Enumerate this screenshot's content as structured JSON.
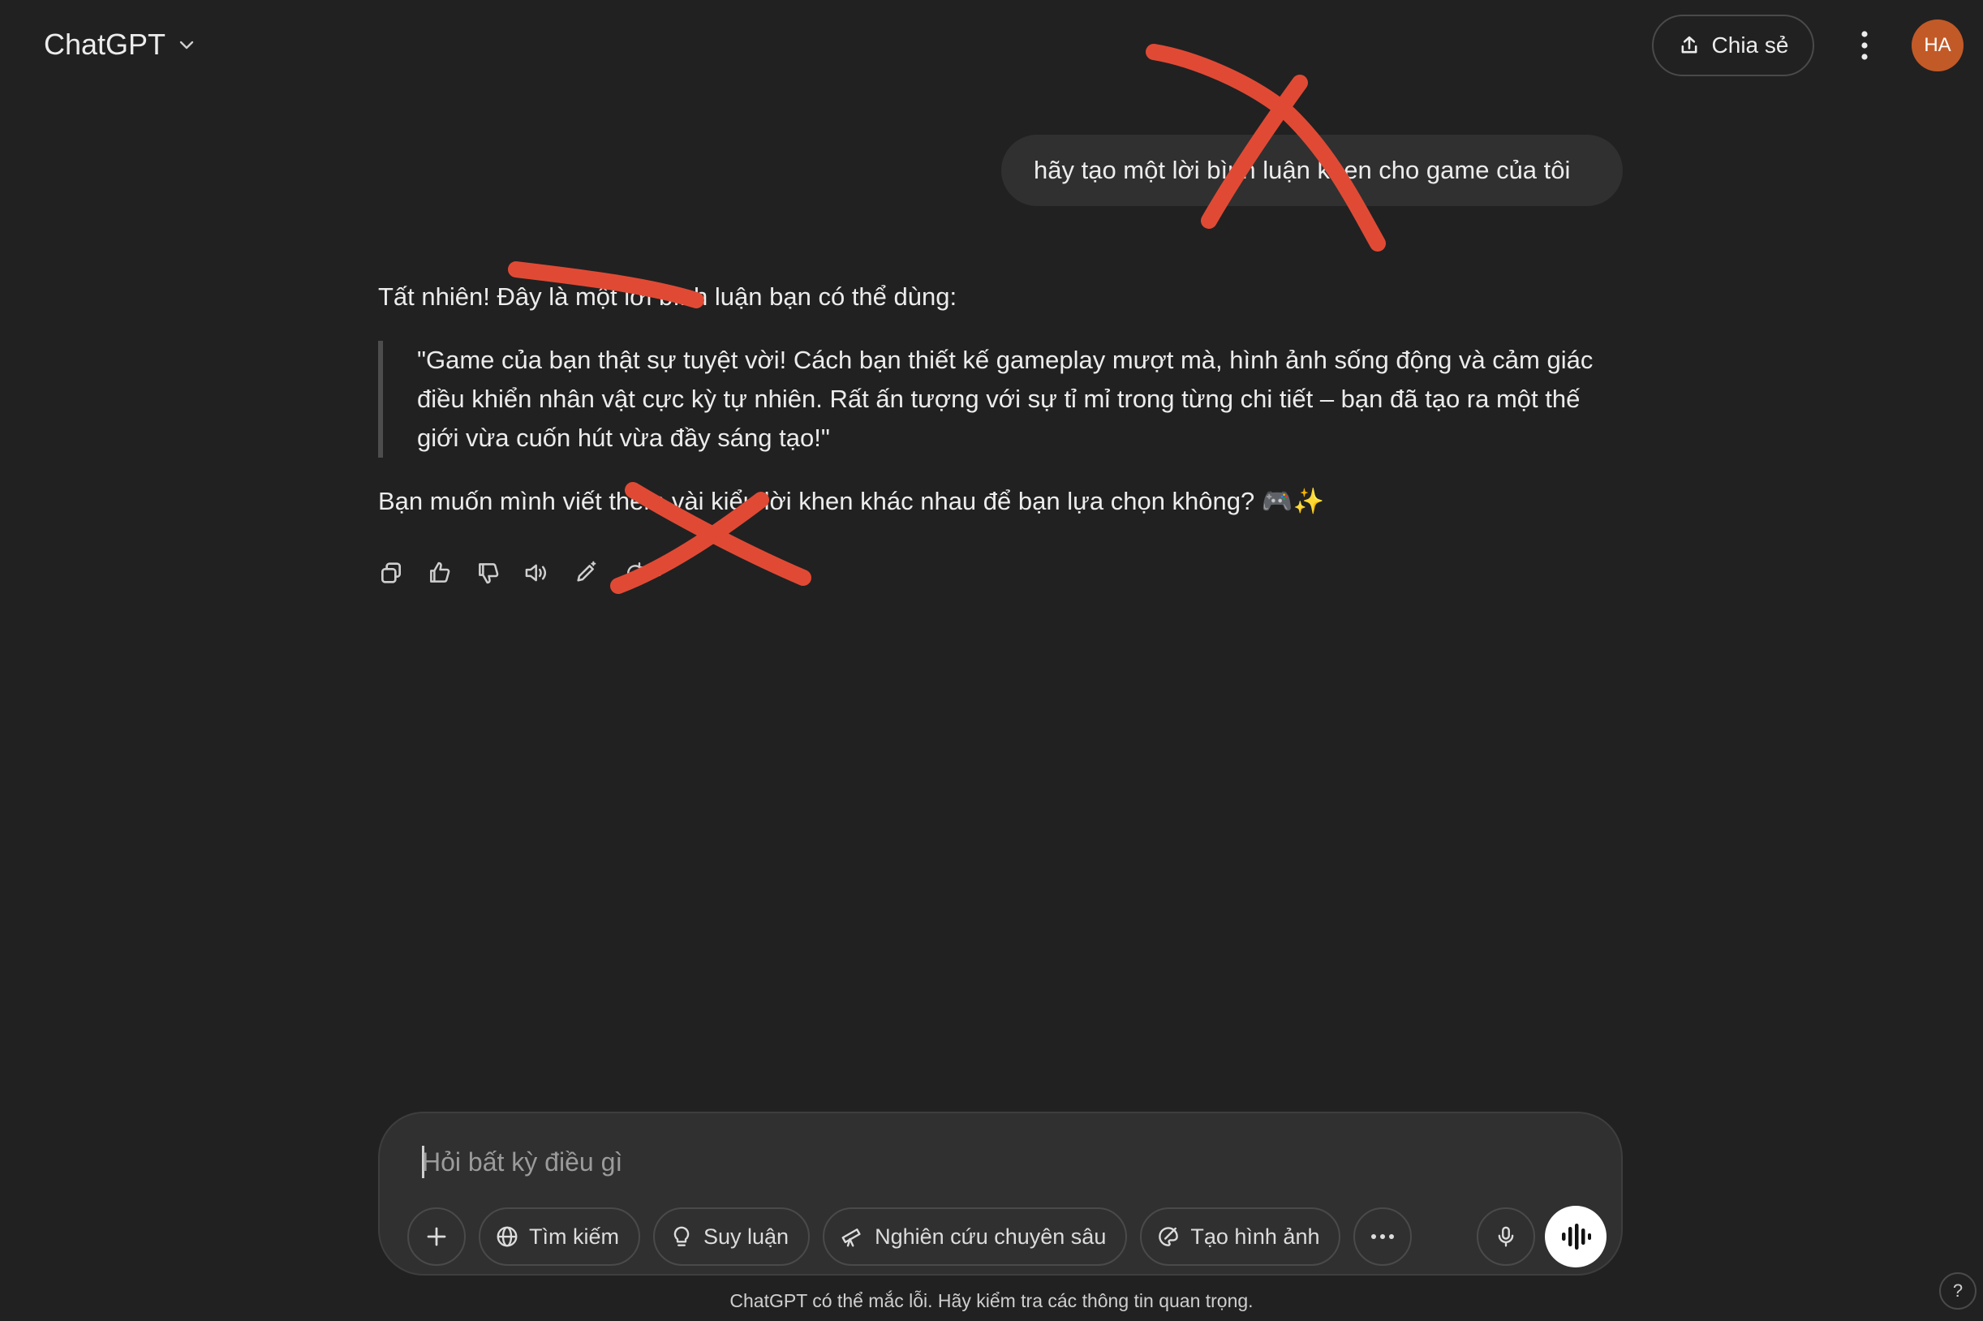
{
  "header": {
    "model_name": "ChatGPT",
    "share_label": "Chia sẻ",
    "avatar_initials": "HA"
  },
  "conversation": {
    "user_message": "hãy tạo một lời bình luận khen cho game của tôi",
    "assistant": {
      "intro": "Tất nhiên! Đây là một lời bình luận bạn có thể dùng:",
      "quote": "\"Game của bạn thật sự tuyệt vời! Cách bạn thiết kế gameplay mượt mà, hình ảnh sống động và cảm giác điều khiển nhân vật cực kỳ tự nhiên. Rất ấn tượng với sự tỉ mỉ trong từng chi tiết – bạn đã tạo ra một thế giới vừa cuốn hút vừa đầy sáng tạo!\"",
      "followup": "Bạn muốn mình viết thêm vài kiểu lời khen khác nhau để bạn lựa chọn không? 🎮✨"
    }
  },
  "composer": {
    "placeholder": "Hỏi bất kỳ điều gì",
    "tools": {
      "search": "Tìm kiếm",
      "reason": "Suy luận",
      "deep_research": "Nghiên cứu chuyên sâu",
      "create_image": "Tạo hình ảnh"
    }
  },
  "footer": {
    "disclaimer": "ChatGPT có thể mắc lỗi. Hãy kiểm tra các thông tin quan trọng.",
    "help": "?"
  },
  "colors": {
    "background": "#212121",
    "bubble": "#303030",
    "avatar": "#c25a27",
    "scribble": "#e04a35"
  },
  "icons": [
    "chevron-down-icon",
    "share-icon",
    "kebab-icon",
    "copy-icon",
    "thumbs-up-icon",
    "thumbs-down-icon",
    "read-aloud-icon",
    "edit-icon",
    "retry-icon",
    "plus-icon",
    "globe-icon",
    "lightbulb-icon",
    "telescope-icon",
    "paint-icon",
    "more-icon",
    "mic-icon",
    "voice-icon"
  ]
}
